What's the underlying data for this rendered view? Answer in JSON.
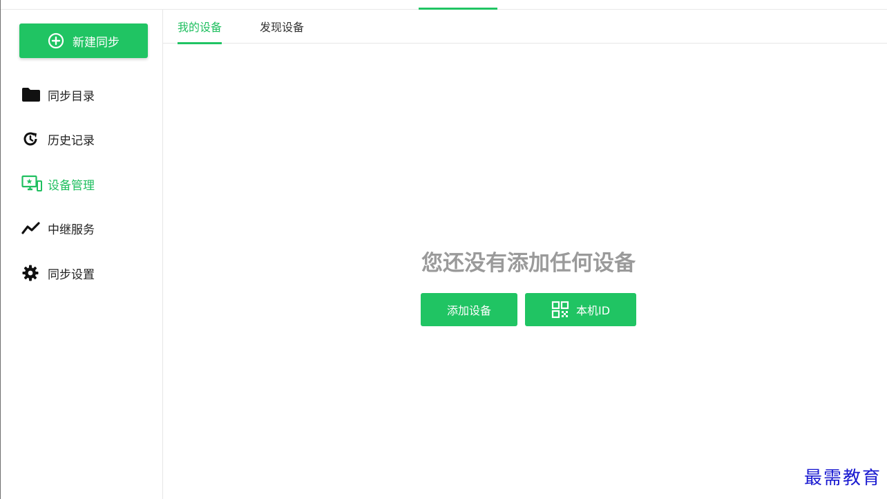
{
  "sidebar": {
    "new_sync_label": "新建同步",
    "items": [
      {
        "label": "同步目录",
        "icon": "folder-icon"
      },
      {
        "label": "历史记录",
        "icon": "history-icon"
      },
      {
        "label": "设备管理",
        "icon": "device-manage-icon",
        "active": true
      },
      {
        "label": "中继服务",
        "icon": "relay-icon"
      },
      {
        "label": "同步设置",
        "icon": "gear-icon"
      }
    ]
  },
  "tabs": [
    {
      "label": "我的设备",
      "active": true
    },
    {
      "label": "发现设备",
      "active": false
    }
  ],
  "main": {
    "empty_message": "您还没有添加任何设备",
    "add_device_label": "添加设备",
    "local_id_label": "本机ID"
  },
  "watermark": "最需教育",
  "colors": {
    "accent": "#20c463",
    "empty_text": "#9a9a9a",
    "watermark": "#1a1ad0"
  }
}
